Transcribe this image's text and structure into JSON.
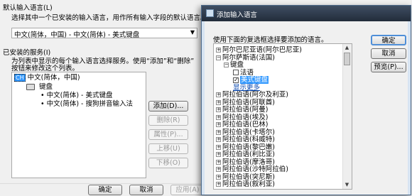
{
  "settings": {
    "default_lang_title": "默认输入语言(L)",
    "default_lang_desc": "选择其中一个已安装的输入语言，用作所有输入字段的默认语言。",
    "default_lang_value": "中文(简体，中国) - 中文(简体) - 美式键盘",
    "services_title": "已安装的服务(I)",
    "services_desc1": "为列表中显示的每个输入语言选择服务。使用“添加”和“删除”",
    "services_desc2": "按钮来修改这个列表。",
    "tree": {
      "lang_badge": "CH",
      "lang": "中文(简体，中国)",
      "keyboard": "键盘",
      "items": [
        "• 中文(简体) - 美式键盘",
        "• 中文(简体) - 搜狗拼音输入法"
      ]
    },
    "buttons": {
      "add": "添加(D)...",
      "remove": "删除(R)",
      "props": "属性(P)...",
      "up": "上移(U)",
      "down": "下移(O)"
    },
    "bottom": {
      "ok": "确定",
      "cancel": "取消",
      "apply": "应用(A)"
    }
  },
  "dialog": {
    "title": "添加输入语言",
    "instruction": "使用下面的复选框选择要添加的语言。",
    "buttons": {
      "ok": "确定",
      "cancel": "取消",
      "preview": "预览(P)..."
    },
    "tree": [
      {
        "label": "阿尔巴尼亚语(阿尔巴尼亚)",
        "level": 0,
        "exp": "+"
      },
      {
        "label": "阿尔萨斯语(法国)",
        "level": 0,
        "exp": "−"
      },
      {
        "label": "键盘",
        "level": 1,
        "exp": "−"
      },
      {
        "label": "法语",
        "level": 2,
        "check": ""
      },
      {
        "label": "美式键盘",
        "level": 2,
        "check": "✓",
        "selected": true
      },
      {
        "label": "显示更多",
        "level": 2,
        "link": true
      },
      {
        "label": "阿拉伯语(阿尔及利亚)",
        "level": 0,
        "exp": "+"
      },
      {
        "label": "阿拉伯语(阿联酋)",
        "level": 0,
        "exp": "+"
      },
      {
        "label": "阿拉伯语(阿曼)",
        "level": 0,
        "exp": "+"
      },
      {
        "label": "阿拉伯语(埃及)",
        "level": 0,
        "exp": "+"
      },
      {
        "label": "阿拉伯语(巴林)",
        "level": 0,
        "exp": "+"
      },
      {
        "label": "阿拉伯语(卡塔尔)",
        "level": 0,
        "exp": "+"
      },
      {
        "label": "阿拉伯语(科威特)",
        "level": 0,
        "exp": "+"
      },
      {
        "label": "阿拉伯语(黎巴嫩)",
        "level": 0,
        "exp": "+"
      },
      {
        "label": "阿拉伯语(利比亚)",
        "level": 0,
        "exp": "+"
      },
      {
        "label": "阿拉伯语(摩洛哥)",
        "level": 0,
        "exp": "+"
      },
      {
        "label": "阿拉伯语(沙特阿拉伯)",
        "level": 0,
        "exp": "+"
      },
      {
        "label": "阿拉伯语(突尼斯)",
        "level": 0,
        "exp": "+"
      },
      {
        "label": "阿拉伯语(叙利亚)",
        "level": 0,
        "exp": "+"
      }
    ]
  }
}
